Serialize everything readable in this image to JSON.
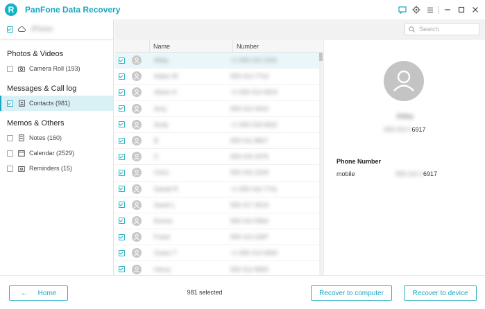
{
  "app": {
    "title": "PanFone Data Recovery",
    "logo_letter": "R",
    "accent": "#1aa7bf"
  },
  "titlebar_icons": [
    "feedback-icon",
    "settings-icon",
    "menu-icon",
    "minimize-icon",
    "maximize-icon",
    "close-icon"
  ],
  "device": {
    "name": "iPhone"
  },
  "sidebar": {
    "sections": [
      {
        "heading": "Photos & Videos",
        "items": [
          {
            "label": "Camera Roll (193)",
            "icon": "camera-icon",
            "checked": false,
            "active": false
          }
        ]
      },
      {
        "heading": "Messages & Call log",
        "items": [
          {
            "label": "Contacts (981)",
            "icon": "contacts-icon",
            "checked": true,
            "active": true
          }
        ]
      },
      {
        "heading": "Memos & Others",
        "items": [
          {
            "label": "Notes (160)",
            "icon": "notes-icon",
            "checked": false,
            "active": false
          },
          {
            "label": "Calendar (2529)",
            "icon": "calendar-icon",
            "checked": false,
            "active": false
          },
          {
            "label": "Reminders (15)",
            "icon": "reminders-icon",
            "checked": false,
            "active": false
          }
        ]
      }
    ]
  },
  "search": {
    "placeholder": "Search"
  },
  "table": {
    "columns": [
      "Name",
      "Number"
    ],
    "rows": [
      {
        "name": "Abby",
        "number": "+1 555 010 2231"
      },
      {
        "name": "Adam W",
        "number": "555 013 7714"
      },
      {
        "name": "Alison K",
        "number": "+1 555 014 9023"
      },
      {
        "name": "Amy",
        "number": "555 012 4410"
      },
      {
        "name": "Andy",
        "number": "+1 555 018 6632"
      },
      {
        "name": "B",
        "number": "555 011 8827"
      },
      {
        "name": "C",
        "number": "555 019 3376"
      },
      {
        "name": "Chris",
        "number": "555 015 2209"
      },
      {
        "name": "Daniel R",
        "number": "+1 555 016 7741"
      },
      {
        "name": "David L",
        "number": "555 017 5519"
      },
      {
        "name": "Emma",
        "number": "555 010 9964"
      },
      {
        "name": "Frank",
        "number": "555 013 2287"
      },
      {
        "name": "Grace T",
        "number": "+1 555 014 6653"
      },
      {
        "name": "Henry",
        "number": "555 012 8830"
      }
    ]
  },
  "detail": {
    "name": "Abby",
    "phone_masked": "6917",
    "phone_prefix_blur": "555 010 2",
    "section_label": "Phone Number",
    "type": "mobile",
    "value_masked": "6917"
  },
  "footer": {
    "home_label": "Home",
    "selected_text": "981 selected",
    "recover_computer": "Recover to computer",
    "recover_device": "Recover to device"
  }
}
